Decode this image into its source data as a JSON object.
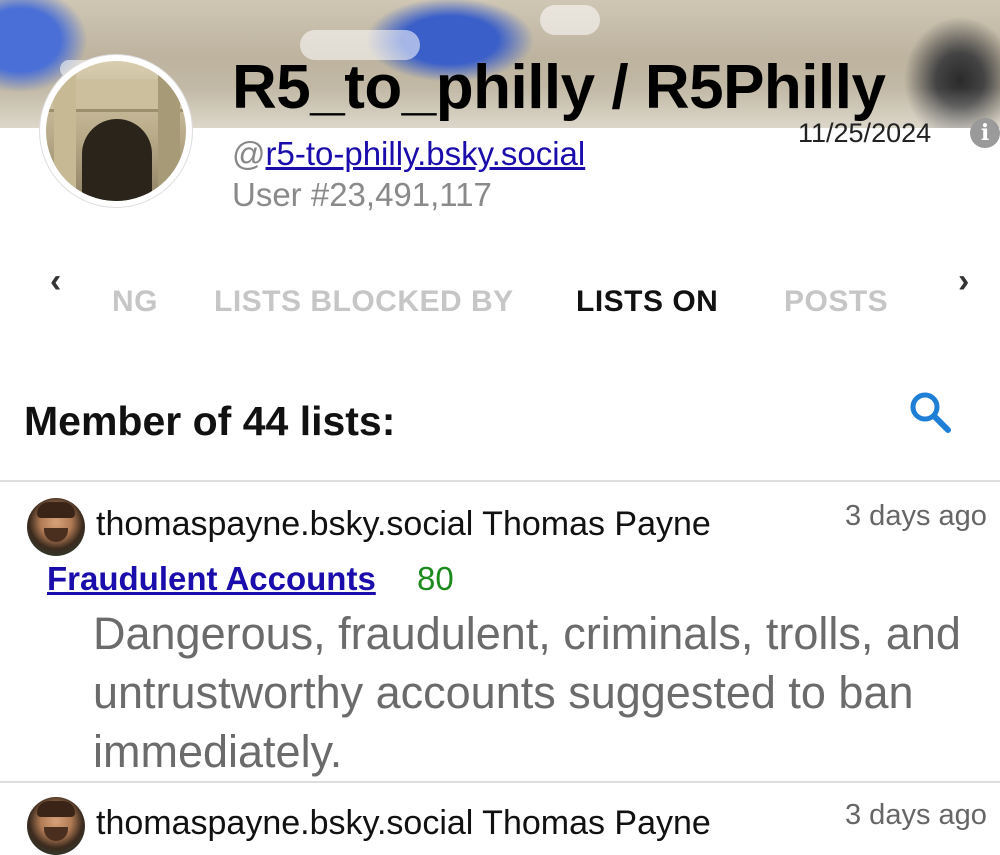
{
  "profile": {
    "display_name": "R5_to_philly / R5Philly",
    "handle_prefix": "@",
    "handle": "r5-to-philly.bsky.social",
    "user_number": "User #23,491,117",
    "joined_date": "11/25/2024",
    "info_icon": "info-icon"
  },
  "tabs": {
    "prev_icon": "‹",
    "next_icon": "›",
    "items": [
      {
        "label": "NG",
        "active": false
      },
      {
        "label": "LISTS BLOCKED BY",
        "active": false
      },
      {
        "label": "LISTS ON",
        "active": true
      },
      {
        "label": "POSTS",
        "active": false
      }
    ]
  },
  "lists_section": {
    "heading": "Member of 44 lists:",
    "search_icon": "search-icon",
    "accent_color": "#1f7fd6",
    "items": [
      {
        "owner": "thomaspayne.bsky.social Thomas Payne",
        "time": "3 days ago",
        "list_name": "Fraudulent Accounts",
        "count": "80",
        "description": "Dangerous, fraudulent, criminals, trolls, and untrustworthy accounts suggested to ban immediately."
      },
      {
        "owner": "thomaspayne.bsky.social Thomas Payne",
        "time": "3 days ago"
      }
    ]
  },
  "colors": {
    "link": "#1a0dab",
    "count": "#1c8a1c",
    "inactive_tab": "#c6c6c6"
  }
}
